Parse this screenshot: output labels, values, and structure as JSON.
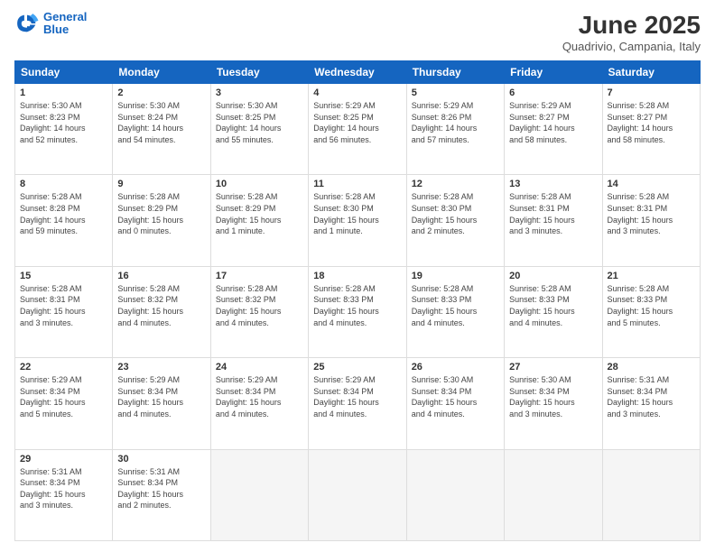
{
  "header": {
    "logo_line1": "General",
    "logo_line2": "Blue",
    "month": "June 2025",
    "location": "Quadrivio, Campania, Italy"
  },
  "weekdays": [
    "Sunday",
    "Monday",
    "Tuesday",
    "Wednesday",
    "Thursday",
    "Friday",
    "Saturday"
  ],
  "weeks": [
    [
      {
        "day": "1",
        "info": "Sunrise: 5:30 AM\nSunset: 8:23 PM\nDaylight: 14 hours\nand 52 minutes."
      },
      {
        "day": "2",
        "info": "Sunrise: 5:30 AM\nSunset: 8:24 PM\nDaylight: 14 hours\nand 54 minutes."
      },
      {
        "day": "3",
        "info": "Sunrise: 5:30 AM\nSunset: 8:25 PM\nDaylight: 14 hours\nand 55 minutes."
      },
      {
        "day": "4",
        "info": "Sunrise: 5:29 AM\nSunset: 8:25 PM\nDaylight: 14 hours\nand 56 minutes."
      },
      {
        "day": "5",
        "info": "Sunrise: 5:29 AM\nSunset: 8:26 PM\nDaylight: 14 hours\nand 57 minutes."
      },
      {
        "day": "6",
        "info": "Sunrise: 5:29 AM\nSunset: 8:27 PM\nDaylight: 14 hours\nand 58 minutes."
      },
      {
        "day": "7",
        "info": "Sunrise: 5:28 AM\nSunset: 8:27 PM\nDaylight: 14 hours\nand 58 minutes."
      }
    ],
    [
      {
        "day": "8",
        "info": "Sunrise: 5:28 AM\nSunset: 8:28 PM\nDaylight: 14 hours\nand 59 minutes."
      },
      {
        "day": "9",
        "info": "Sunrise: 5:28 AM\nSunset: 8:29 PM\nDaylight: 15 hours\nand 0 minutes."
      },
      {
        "day": "10",
        "info": "Sunrise: 5:28 AM\nSunset: 8:29 PM\nDaylight: 15 hours\nand 1 minute."
      },
      {
        "day": "11",
        "info": "Sunrise: 5:28 AM\nSunset: 8:30 PM\nDaylight: 15 hours\nand 1 minute."
      },
      {
        "day": "12",
        "info": "Sunrise: 5:28 AM\nSunset: 8:30 PM\nDaylight: 15 hours\nand 2 minutes."
      },
      {
        "day": "13",
        "info": "Sunrise: 5:28 AM\nSunset: 8:31 PM\nDaylight: 15 hours\nand 3 minutes."
      },
      {
        "day": "14",
        "info": "Sunrise: 5:28 AM\nSunset: 8:31 PM\nDaylight: 15 hours\nand 3 minutes."
      }
    ],
    [
      {
        "day": "15",
        "info": "Sunrise: 5:28 AM\nSunset: 8:31 PM\nDaylight: 15 hours\nand 3 minutes."
      },
      {
        "day": "16",
        "info": "Sunrise: 5:28 AM\nSunset: 8:32 PM\nDaylight: 15 hours\nand 4 minutes."
      },
      {
        "day": "17",
        "info": "Sunrise: 5:28 AM\nSunset: 8:32 PM\nDaylight: 15 hours\nand 4 minutes."
      },
      {
        "day": "18",
        "info": "Sunrise: 5:28 AM\nSunset: 8:33 PM\nDaylight: 15 hours\nand 4 minutes."
      },
      {
        "day": "19",
        "info": "Sunrise: 5:28 AM\nSunset: 8:33 PM\nDaylight: 15 hours\nand 4 minutes."
      },
      {
        "day": "20",
        "info": "Sunrise: 5:28 AM\nSunset: 8:33 PM\nDaylight: 15 hours\nand 4 minutes."
      },
      {
        "day": "21",
        "info": "Sunrise: 5:28 AM\nSunset: 8:33 PM\nDaylight: 15 hours\nand 5 minutes."
      }
    ],
    [
      {
        "day": "22",
        "info": "Sunrise: 5:29 AM\nSunset: 8:34 PM\nDaylight: 15 hours\nand 5 minutes."
      },
      {
        "day": "23",
        "info": "Sunrise: 5:29 AM\nSunset: 8:34 PM\nDaylight: 15 hours\nand 4 minutes."
      },
      {
        "day": "24",
        "info": "Sunrise: 5:29 AM\nSunset: 8:34 PM\nDaylight: 15 hours\nand 4 minutes."
      },
      {
        "day": "25",
        "info": "Sunrise: 5:29 AM\nSunset: 8:34 PM\nDaylight: 15 hours\nand 4 minutes."
      },
      {
        "day": "26",
        "info": "Sunrise: 5:30 AM\nSunset: 8:34 PM\nDaylight: 15 hours\nand 4 minutes."
      },
      {
        "day": "27",
        "info": "Sunrise: 5:30 AM\nSunset: 8:34 PM\nDaylight: 15 hours\nand 3 minutes."
      },
      {
        "day": "28",
        "info": "Sunrise: 5:31 AM\nSunset: 8:34 PM\nDaylight: 15 hours\nand 3 minutes."
      }
    ],
    [
      {
        "day": "29",
        "info": "Sunrise: 5:31 AM\nSunset: 8:34 PM\nDaylight: 15 hours\nand 3 minutes."
      },
      {
        "day": "30",
        "info": "Sunrise: 5:31 AM\nSunset: 8:34 PM\nDaylight: 15 hours\nand 2 minutes."
      },
      {
        "day": "",
        "info": ""
      },
      {
        "day": "",
        "info": ""
      },
      {
        "day": "",
        "info": ""
      },
      {
        "day": "",
        "info": ""
      },
      {
        "day": "",
        "info": ""
      }
    ]
  ]
}
